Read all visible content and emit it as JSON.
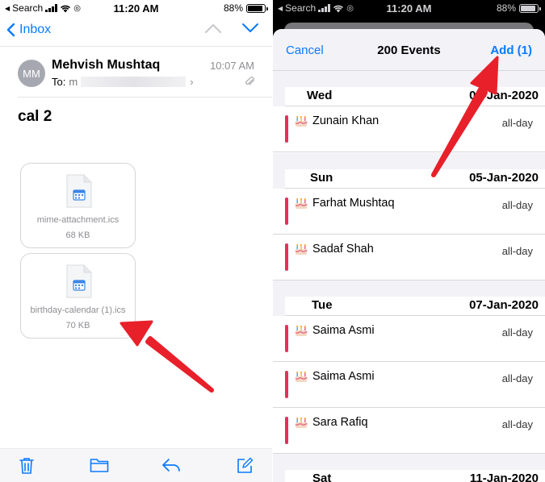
{
  "left_status": {
    "carrier": "Search",
    "time": "11:20 AM",
    "battery": "88%"
  },
  "right_status": {
    "carrier": "Search",
    "time": "11:20 AM",
    "battery": "88%"
  },
  "mail": {
    "back_label": "Inbox",
    "sender_initials": "MM",
    "sender_name": "Mehvish Mushtaq",
    "to_prefix": "To:",
    "to_visible": "m",
    "time": "10:07 AM",
    "subject": "cal 2",
    "attachments": [
      {
        "name": "mime-attachment.ics",
        "size": "68 KB"
      },
      {
        "name": "birthday-calendar (1).ics",
        "size": "70 KB"
      }
    ]
  },
  "sheet": {
    "cancel_label": "Cancel",
    "title": "200 Events",
    "add_label": "Add (1)",
    "groups": [
      {
        "day": "Wed",
        "date": "01-Jan-2020",
        "events": [
          {
            "name": "Zunain Khan",
            "when": "all-day"
          }
        ]
      },
      {
        "day": "Sun",
        "date": "05-Jan-2020",
        "events": [
          {
            "name": "Farhat Mushtaq",
            "when": "all-day"
          },
          {
            "name": "Sadaf Shah",
            "when": "all-day"
          }
        ]
      },
      {
        "day": "Tue",
        "date": "07-Jan-2020",
        "events": [
          {
            "name": "Saima Asmi",
            "when": "all-day"
          },
          {
            "name": "Saima Asmi",
            "when": "all-day"
          },
          {
            "name": "Sara Rafiq",
            "when": "all-day"
          }
        ]
      },
      {
        "day": "Sat",
        "date": "11-Jan-2020",
        "events": []
      }
    ]
  },
  "colors": {
    "accent": "#0a7aff",
    "event_strip": "#e4305a",
    "annotation_arrow": "#e8202a"
  },
  "icons": [
    "chevron-left-icon",
    "chevron-up-icon",
    "chevron-down-icon",
    "paperclip-icon",
    "calendar-file-icon",
    "birthday-cake-icon",
    "trash-icon",
    "folder-icon",
    "reply-icon",
    "compose-icon"
  ]
}
